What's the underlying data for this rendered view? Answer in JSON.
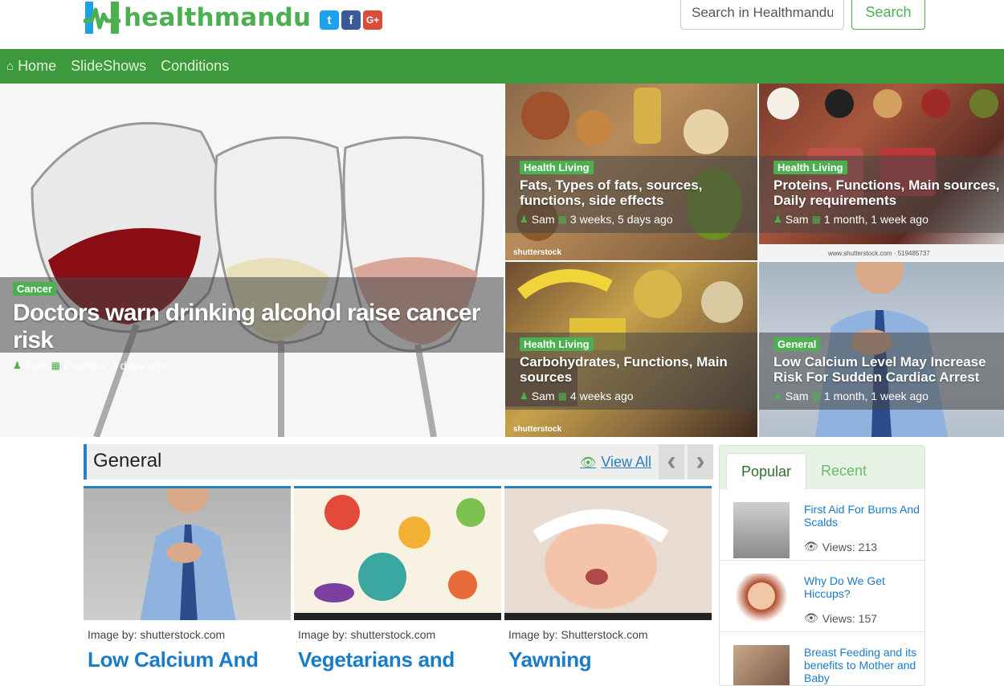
{
  "header": {
    "brand": "healthmandu",
    "social": [
      {
        "name": "twitter-icon",
        "glyph": "t"
      },
      {
        "name": "facebook-icon",
        "glyph": "f"
      },
      {
        "name": "google-plus-icon",
        "glyph": "G+"
      }
    ],
    "search_placeholder": "Search in Healthmandu",
    "search_button": "Search"
  },
  "nav": {
    "items": [
      "Home",
      "SlideShows",
      "Conditions"
    ]
  },
  "hero": {
    "main": {
      "category": "Cancer",
      "title": "Doctors warn drinking alcohol raise cancer risk",
      "author": "Sam",
      "date": "2 weeks, 3 days ago"
    },
    "tiles": [
      {
        "category": "Health Living",
        "title": "Fats, Types of fats, sources, functions, side effects",
        "author": "Sam",
        "date": "3 weeks, 5 days ago",
        "watermark": "shutterstock"
      },
      {
        "category": "Health Living",
        "title": "Proteins, Functions, Main sources, Daily requirements",
        "author": "Sam",
        "date": "1 month, 1 week ago",
        "watermark": "www.shutterstock.com · 519485737"
      },
      {
        "category": "Health Living",
        "title": "Carbohydrates, Functions, Main sources",
        "author": "Sam",
        "date": "4 weeks ago",
        "watermark": "shutterstock"
      },
      {
        "category": "General",
        "title": "Low Calcium Level May Increase Risk For Sudden Cardiac Arrest",
        "author": "Sam",
        "date": "1 month, 1 week ago"
      }
    ]
  },
  "general": {
    "title": "General",
    "view_all": "View All",
    "prev": "‹",
    "next": "›",
    "cards": [
      {
        "caption": "Image by: shutterstock.com",
        "title": "Low Calcium And"
      },
      {
        "caption": "Image by: shutterstock.com",
        "title": "Vegetarians and"
      },
      {
        "caption": "Image by: Shutterstock.com",
        "title": "Yawning"
      }
    ]
  },
  "sidebar": {
    "tabs": [
      "Popular",
      "Recent"
    ],
    "items": [
      {
        "title": "First Aid For Burns And Scalds",
        "views": "Views: 213"
      },
      {
        "title": "Why Do We Get Hiccups?",
        "views": "Views: 157"
      },
      {
        "title": "Breast Feeding and its benefits to Mother and Baby",
        "views": ""
      }
    ]
  }
}
